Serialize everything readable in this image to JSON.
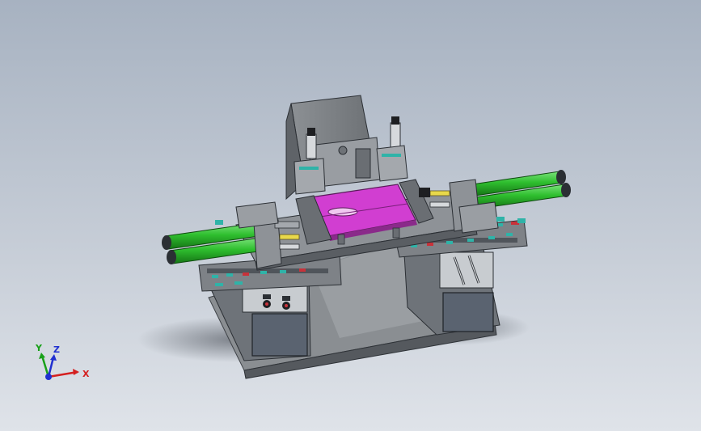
{
  "viewport": {
    "background_top": "#a7b2c1",
    "background_bottom": "#dfe3e9"
  },
  "model": {
    "colors": {
      "frame": "#7a7e82",
      "frame_dark": "#4a4e54",
      "cabinet_glass": "#5c6470",
      "steel": "#9a9ea3",
      "cylinder_green": "#2fbf2f",
      "fixture_magenta": "#d13ed1",
      "accent_teal": "#2fb3a8",
      "accent_red": "#c8323a",
      "accent_yellow": "#e8d84a"
    }
  },
  "triad": {
    "x_label": "X",
    "y_label": "Y",
    "z_label": "Z",
    "x_color": "#d42020",
    "y_color": "#18a018",
    "z_color": "#2030d0",
    "origin_icon": "axis-origin-icon"
  }
}
